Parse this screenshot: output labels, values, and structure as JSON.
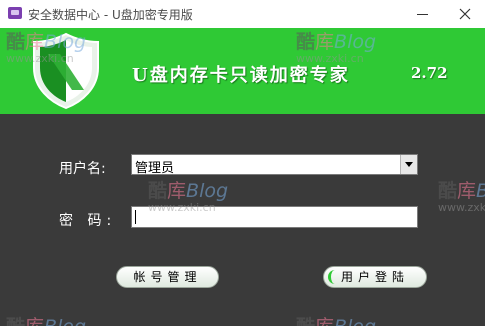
{
  "window": {
    "title": "安全数据中心 - U盘加密专用版",
    "minimize_label": "",
    "close_label": ""
  },
  "banner": {
    "title": "U盘内存卡只读加密专家",
    "version": "2.72",
    "background_color": "#2fc935"
  },
  "form": {
    "username_label": "用户名:",
    "username_value": "管理员",
    "password_label": "密 码:",
    "password_value": ""
  },
  "buttons": {
    "account_manage": "帐号管理",
    "login": "用户登陆"
  },
  "watermark": {
    "brand": [
      "酷",
      "库",
      "Blog"
    ],
    "url": "www.zxki.cn"
  },
  "colors": {
    "panel": "#3a3a3a",
    "accent": "#2fc935"
  }
}
